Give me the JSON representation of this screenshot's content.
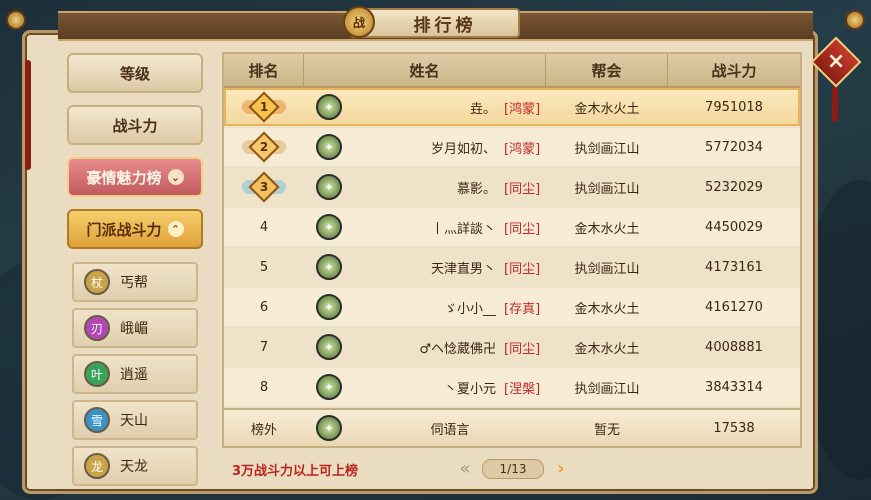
{
  "title": "排行榜",
  "title_emblem": "战",
  "close_icon": "close-icon",
  "sidebar": {
    "categories": [
      {
        "label": "等级",
        "style": "normal"
      },
      {
        "label": "战斗力",
        "style": "normal"
      },
      {
        "label": "豪情魅力榜",
        "style": "pink",
        "chevron": "⌄"
      },
      {
        "label": "门派战斗力",
        "style": "gold",
        "chevron": "⌃"
      }
    ],
    "sects": [
      {
        "label": "丐帮",
        "icon": "staff-icon",
        "color": "#c9a347"
      },
      {
        "label": "峨嵋",
        "icon": "blade-icon",
        "color": "#b248b5"
      },
      {
        "label": "逍遥",
        "icon": "leaf-icon",
        "color": "#3aa35a"
      },
      {
        "label": "天山",
        "icon": "snowflake-icon",
        "color": "#3a92c9"
      },
      {
        "label": "天龙",
        "icon": "dragon-icon",
        "color": "#c9a347"
      }
    ]
  },
  "table": {
    "headers": [
      "排名",
      "姓名",
      "帮会",
      "战斗力"
    ],
    "rows": [
      {
        "rank": "1",
        "medal": "gold",
        "name": "垚。",
        "tag": "[鸿蒙]",
        "guild": "金木水火土",
        "power": "7951018"
      },
      {
        "rank": "2",
        "medal": "silver",
        "name": "岁月如初、",
        "tag": "[鸿蒙]",
        "guild": "执剑画江山",
        "power": "5772034"
      },
      {
        "rank": "3",
        "medal": "bronze",
        "name": "慕影。",
        "tag": "[同尘]",
        "guild": "执剑画江山",
        "power": "5232029"
      },
      {
        "rank": "4",
        "medal": "",
        "name": "丨灬詳談丶",
        "tag": "[同尘]",
        "guild": "金木水火土",
        "power": "4450029"
      },
      {
        "rank": "5",
        "medal": "",
        "name": "天津直男丶",
        "tag": "[同尘]",
        "guild": "执剑画江山",
        "power": "4173161"
      },
      {
        "rank": "6",
        "medal": "",
        "name": "ゞ小小__",
        "tag": "[存真]",
        "guild": "金木水火土",
        "power": "4161270"
      },
      {
        "rank": "7",
        "medal": "",
        "name": "♂ヘ惗葳佛卍",
        "tag": "[同尘]",
        "guild": "金木水火土",
        "power": "4008881"
      },
      {
        "rank": "8",
        "medal": "",
        "name": "丶夏小元",
        "tag": "[涅槃]",
        "guild": "执剑画江山",
        "power": "3843314"
      }
    ]
  },
  "self_row": {
    "rank": "榜外",
    "name": "伺语言",
    "guild": "暂无",
    "power": "17538"
  },
  "footer": {
    "note": "3万战斗力以上可上榜",
    "page": "1/13",
    "prev": "«",
    "next": "›"
  }
}
